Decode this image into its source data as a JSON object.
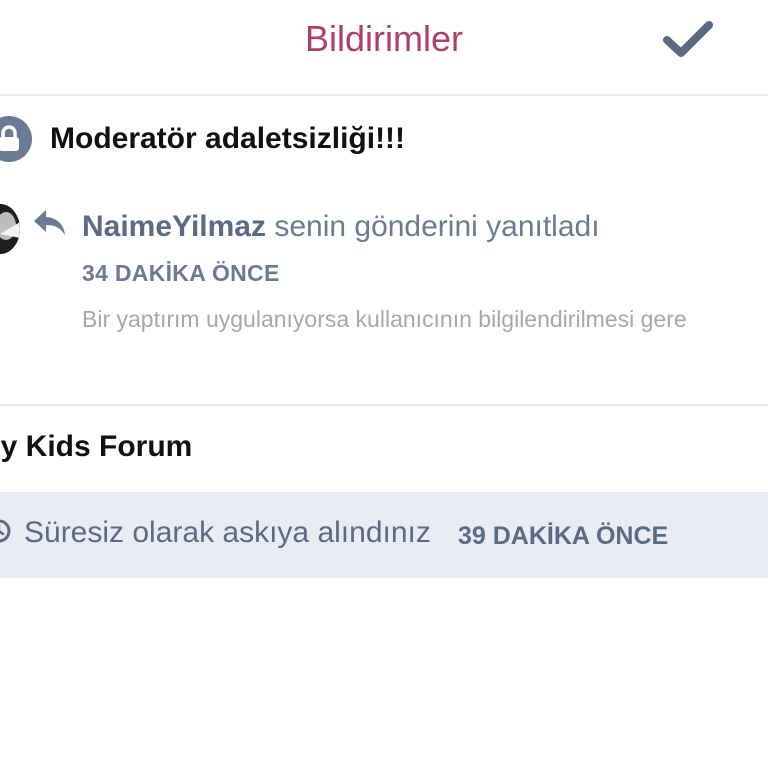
{
  "header": {
    "title": "Bildirimler",
    "confirm_icon": "checkmark-icon"
  },
  "thread": {
    "icon": "lock-icon",
    "title": "Moderatör adaletsizliği!!!",
    "notification": {
      "icon": "reply-icon",
      "user": "NaimeYilmaz",
      "action": "senin gönderini yanıtladı",
      "time": "34 DAKİKA ÖNCE",
      "preview": "Bir yaptırım uygulanıyorsa kullanıcının bilgilendirilmesi gere"
    }
  },
  "forum": {
    "title": "ppy Kids Forum",
    "suspension": {
      "icon": "clock-icon",
      "text": "Süresiz olarak askıya alındınız",
      "time": "39 DAKİKA ÖNCE"
    }
  },
  "colors": {
    "accent": "#b03f66",
    "muted_text": "#6b7a95",
    "banner_bg": "#e9edf3"
  }
}
